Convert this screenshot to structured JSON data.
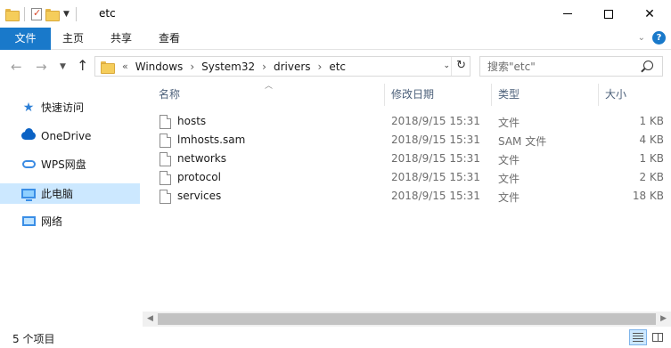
{
  "window": {
    "title": "etc",
    "minimize_label": "—",
    "maximize_label": "☐",
    "close_label": "✕"
  },
  "ribbon": {
    "tabs": [
      {
        "label": "文件"
      },
      {
        "label": "主页"
      },
      {
        "label": "共享"
      },
      {
        "label": "查看"
      }
    ]
  },
  "address": {
    "breadcrumbs": [
      "Windows",
      "System32",
      "drivers",
      "etc"
    ]
  },
  "search": {
    "placeholder": "搜索\"etc\""
  },
  "nav": {
    "items": [
      {
        "label": "快速访问",
        "icon": "star-icon"
      },
      {
        "label": "OneDrive",
        "icon": "cloud-icon"
      },
      {
        "label": "WPS网盘",
        "icon": "cloud-drive-icon"
      },
      {
        "label": "此电脑",
        "icon": "computer-icon",
        "selected": true
      },
      {
        "label": "网络",
        "icon": "network-icon"
      }
    ]
  },
  "columns": {
    "name": "名称",
    "date": "修改日期",
    "type": "类型",
    "size": "大小"
  },
  "files": [
    {
      "name": "hosts",
      "date": "2018/9/15 15:31",
      "type": "文件",
      "size": "1 KB"
    },
    {
      "name": "lmhosts.sam",
      "date": "2018/9/15 15:31",
      "type": "SAM 文件",
      "size": "4 KB"
    },
    {
      "name": "networks",
      "date": "2018/9/15 15:31",
      "type": "文件",
      "size": "1 KB"
    },
    {
      "name": "protocol",
      "date": "2018/9/15 15:31",
      "type": "文件",
      "size": "2 KB"
    },
    {
      "name": "services",
      "date": "2018/9/15 15:31",
      "type": "文件",
      "size": "18 KB"
    }
  ],
  "status": {
    "item_count": "5 个项目"
  },
  "colors": {
    "accent": "#1979ca",
    "selection": "#cce8ff"
  }
}
